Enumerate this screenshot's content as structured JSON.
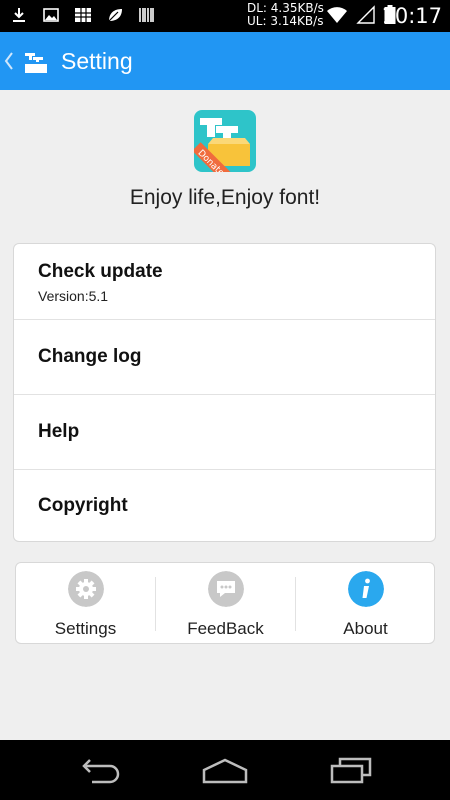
{
  "status_bar": {
    "download": "DL: 4.35KB/s",
    "upload": "UL: 3.14KB/s",
    "time": "10:17"
  },
  "action_bar": {
    "title": "Setting"
  },
  "header": {
    "tagline": "Enjoy life,Enjoy font!",
    "logo_ribbon": "Donate"
  },
  "settings": {
    "items": [
      {
        "label": "Check update",
        "sub": "Version:5.1"
      },
      {
        "label": "Change log"
      },
      {
        "label": "Help"
      },
      {
        "label": "Copyright"
      }
    ]
  },
  "tabs": [
    {
      "label": "Settings",
      "icon": "gear-icon",
      "color": "#c8c8c8"
    },
    {
      "label": "FeedBack",
      "icon": "chat-icon",
      "color": "#c8c8c8"
    },
    {
      "label": "About",
      "icon": "info-icon",
      "color": "#2aa8ee"
    }
  ],
  "colors": {
    "accent": "#2196f3",
    "background": "#efefef"
  }
}
